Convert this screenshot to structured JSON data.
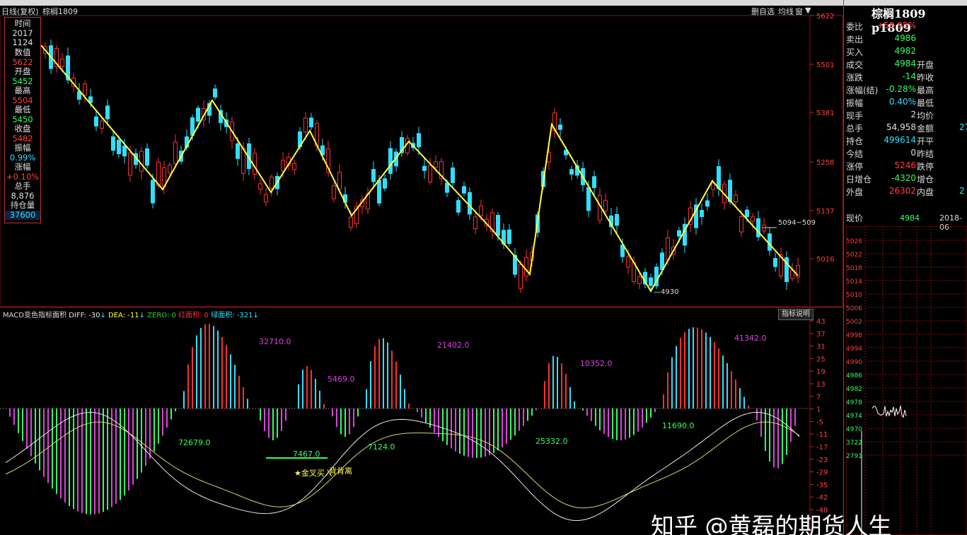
{
  "toolbar": {
    "period": "日线(复权)",
    "symbol": "棕榈1809",
    "redraw": "删自选",
    "avgline": "均线",
    "menu1": "窗",
    "menu2": "▼"
  },
  "info_box": {
    "time_label": "时间",
    "year": "2017",
    "date": "1124",
    "value_label": "数值",
    "value": "5622",
    "open_label": "开盘",
    "open": "5452",
    "high_label": "最高",
    "high": "5504",
    "low_label": "最低",
    "low": "5450",
    "close_label": "收盘",
    "close": "5482",
    "amplitude_label": "振幅",
    "amplitude": "0.99%",
    "change_label": "涨幅",
    "change": "+0.10%",
    "volume_label": "总手",
    "volume": "8,876",
    "oi_label": "持仓量",
    "oi": "37600"
  },
  "price_axis": [
    "5622",
    "5501",
    "5381",
    "5258",
    "5137",
    "5016"
  ],
  "price_annotations": {
    "high_note": "5094~509",
    "low_note": "4930"
  },
  "macd": {
    "title": "MACD变色指标面积",
    "diff": "DIFF: -30",
    "dea": "DEA: -11",
    "zero": "ZERO: 0",
    "red_area": "红面积: 0",
    "green_area": "绿面积: -321",
    "button": "指标说明",
    "axis": [
      "43",
      "37",
      "31",
      "25",
      "19",
      "13",
      "7",
      "1",
      "-5",
      "-11",
      "-17",
      "-23",
      "-29",
      "-35",
      "-42",
      "-48"
    ],
    "area_labels": {
      "r1": "32710.0",
      "r2": "5469.0",
      "r3": "21402.0",
      "r4": "10352.0",
      "r5": "41342.0",
      "g1": "72679.0",
      "g2": "7467.0",
      "g3": "7124.0",
      "g4": "25332.0",
      "g5": "11690.0"
    },
    "cross_note": "金叉买入",
    "cross_note2": "背背离"
  },
  "right_panel": {
    "title": "棕榈1809 p1809",
    "rows": [
      {
        "l": "委比",
        "v": "+58.95%",
        "vc": "r",
        "m": "",
        "v2": ""
      },
      {
        "l": "卖出",
        "v": "4986",
        "vc": "g",
        "m": "",
        "v2": ""
      },
      {
        "l": "买入",
        "v": "4982",
        "vc": "g",
        "m": "",
        "v2": ""
      },
      {
        "l": "成交",
        "v": "4984",
        "vc": "g",
        "m": "开盘",
        "v2": ""
      },
      {
        "l": "涨跌",
        "v": "-14",
        "vc": "g",
        "m": "昨收",
        "v2": ""
      },
      {
        "l": "涨幅(结)",
        "v": "-0.28%",
        "vc": "g",
        "m": "最高",
        "v2": ""
      },
      {
        "l": "振幅",
        "v": "0.40%",
        "vc": "c",
        "m": "最低",
        "v2": ""
      },
      {
        "l": "现手",
        "v": "2",
        "vc": "w",
        "m": "均价",
        "v2": ""
      },
      {
        "l": "总手",
        "v": "54,958",
        "vc": "w",
        "m": "金额",
        "v2": "27"
      },
      {
        "l": "持仓",
        "v": "499614",
        "vc": "c",
        "m": "开平",
        "v2": ""
      },
      {
        "l": "今结",
        "v": "0",
        "vc": "w",
        "m": "昨结",
        "v2": ""
      },
      {
        "l": "涨停",
        "v": "5246",
        "vc": "r",
        "m": "跌停",
        "v2": ""
      },
      {
        "l": "日增仓",
        "v": "-4320",
        "vc": "g",
        "m": "增仓",
        "v2": ""
      },
      {
        "l": "外盘",
        "v": "26302",
        "vc": "r",
        "m": "内盘",
        "v2": "2"
      }
    ],
    "now_label": "现价",
    "now_value": "4984",
    "now_date": "2018-06",
    "mini_axis": [
      "5026",
      "5022",
      "5018",
      "5014",
      "5010",
      "5006",
      "5002",
      "4998",
      "4994",
      "4990",
      "4986",
      "4982",
      "4978",
      "4974",
      "4970",
      "3722",
      "2791"
    ]
  },
  "watermark": "知乎 @黄磊的期货人生",
  "colors": {
    "up": "#ff3030",
    "down": "#30e0ff",
    "zigzag": "#ffff40",
    "grid": "#8b1010"
  }
}
